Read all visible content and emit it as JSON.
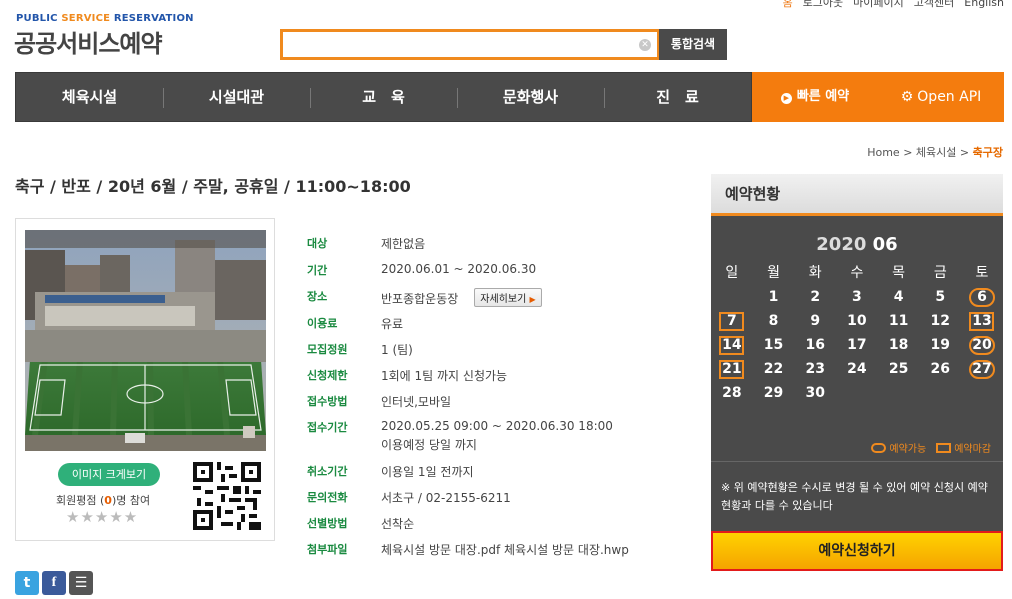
{
  "util_links": [
    "홈",
    "로그아웃",
    "마이페이지",
    "고객센터",
    "English"
  ],
  "logo": {
    "en_prefix": "PUBLIC",
    "en_accent": "SERVICE",
    "en_suffix": "RESERVATION",
    "ko": "공공서비스예약"
  },
  "search": {
    "placeholder": "",
    "button": "통합검색"
  },
  "nav": {
    "items": [
      "체육시설",
      "시설대관",
      "교　육",
      "문화행사",
      "진　료"
    ],
    "quick": "빠른 예약",
    "api": "Open API"
  },
  "breadcrumb": {
    "home": "Home",
    "sep": ">",
    "level1": "체육시설",
    "current": "축구장"
  },
  "title": "축구 / 반포 / 20년 6월 / 주말, 공휴일 / 11:00~18:00",
  "image_card": {
    "enlarge": "이미지 크게보기",
    "rating_prefix": "회원평점 (",
    "rating_count": "0",
    "rating_suffix": ")명 참여",
    "stars": "★★★★★"
  },
  "info": [
    {
      "key": "대상",
      "value": "제한없음"
    },
    {
      "key": "기간",
      "value": "2020.06.01 ~ 2020.06.30"
    },
    {
      "key": "장소",
      "value": "반포종합운동장",
      "button": "자세히보기"
    },
    {
      "key": "이용료",
      "value": "유료"
    },
    {
      "key": "모집정원",
      "value": "1 (팀)"
    },
    {
      "key": "신청제한",
      "value": "1회에 1팀 까지 신청가능"
    },
    {
      "key": "접수방법",
      "value": "인터넷,모바일"
    },
    {
      "key": "접수기간",
      "value": "2020.05.25 09:00 ~ 2020.06.30 18:00",
      "value2": "이용예정 당일 까지"
    },
    {
      "key": "취소기간",
      "value": "이용일 1일 전까지"
    },
    {
      "key": "문의전화",
      "value": "서초구 / 02-2155-6211"
    },
    {
      "key": "선별방법",
      "value": "선착순"
    },
    {
      "key": "첨부파일",
      "value": "체육시설 방문 대장.pdf 체육시설 방문 대장.hwp"
    }
  ],
  "calendar": {
    "header": "예약현황",
    "year": "2020",
    "month": "06",
    "dow": [
      "일",
      "월",
      "화",
      "수",
      "목",
      "금",
      "토"
    ],
    "weeks": [
      [
        "",
        "1",
        "2",
        "3",
        "4",
        "5",
        "6"
      ],
      [
        "7",
        "8",
        "9",
        "10",
        "11",
        "12",
        "13"
      ],
      [
        "14",
        "15",
        "16",
        "17",
        "18",
        "19",
        "20"
      ],
      [
        "21",
        "22",
        "23",
        "24",
        "25",
        "26",
        "27"
      ],
      [
        "28",
        "29",
        "30",
        "",
        "",
        "",
        ""
      ]
    ],
    "available": [
      "6",
      "20",
      "27"
    ],
    "closed": [
      "7",
      "13",
      "14",
      "21"
    ],
    "legend_available": "예약가능",
    "legend_closed": "예약마감",
    "note": "※ 위 예약현황은 수시로 변경 될 수 있어 예약 신청시 예약현황과 다를 수 있습니다"
  },
  "apply_button": "예약신청하기",
  "colors": {
    "accent": "#f08a1e",
    "nav": "#4a4a4a",
    "label_green": "#1a8a40",
    "apply_border": "#e31b1b"
  }
}
